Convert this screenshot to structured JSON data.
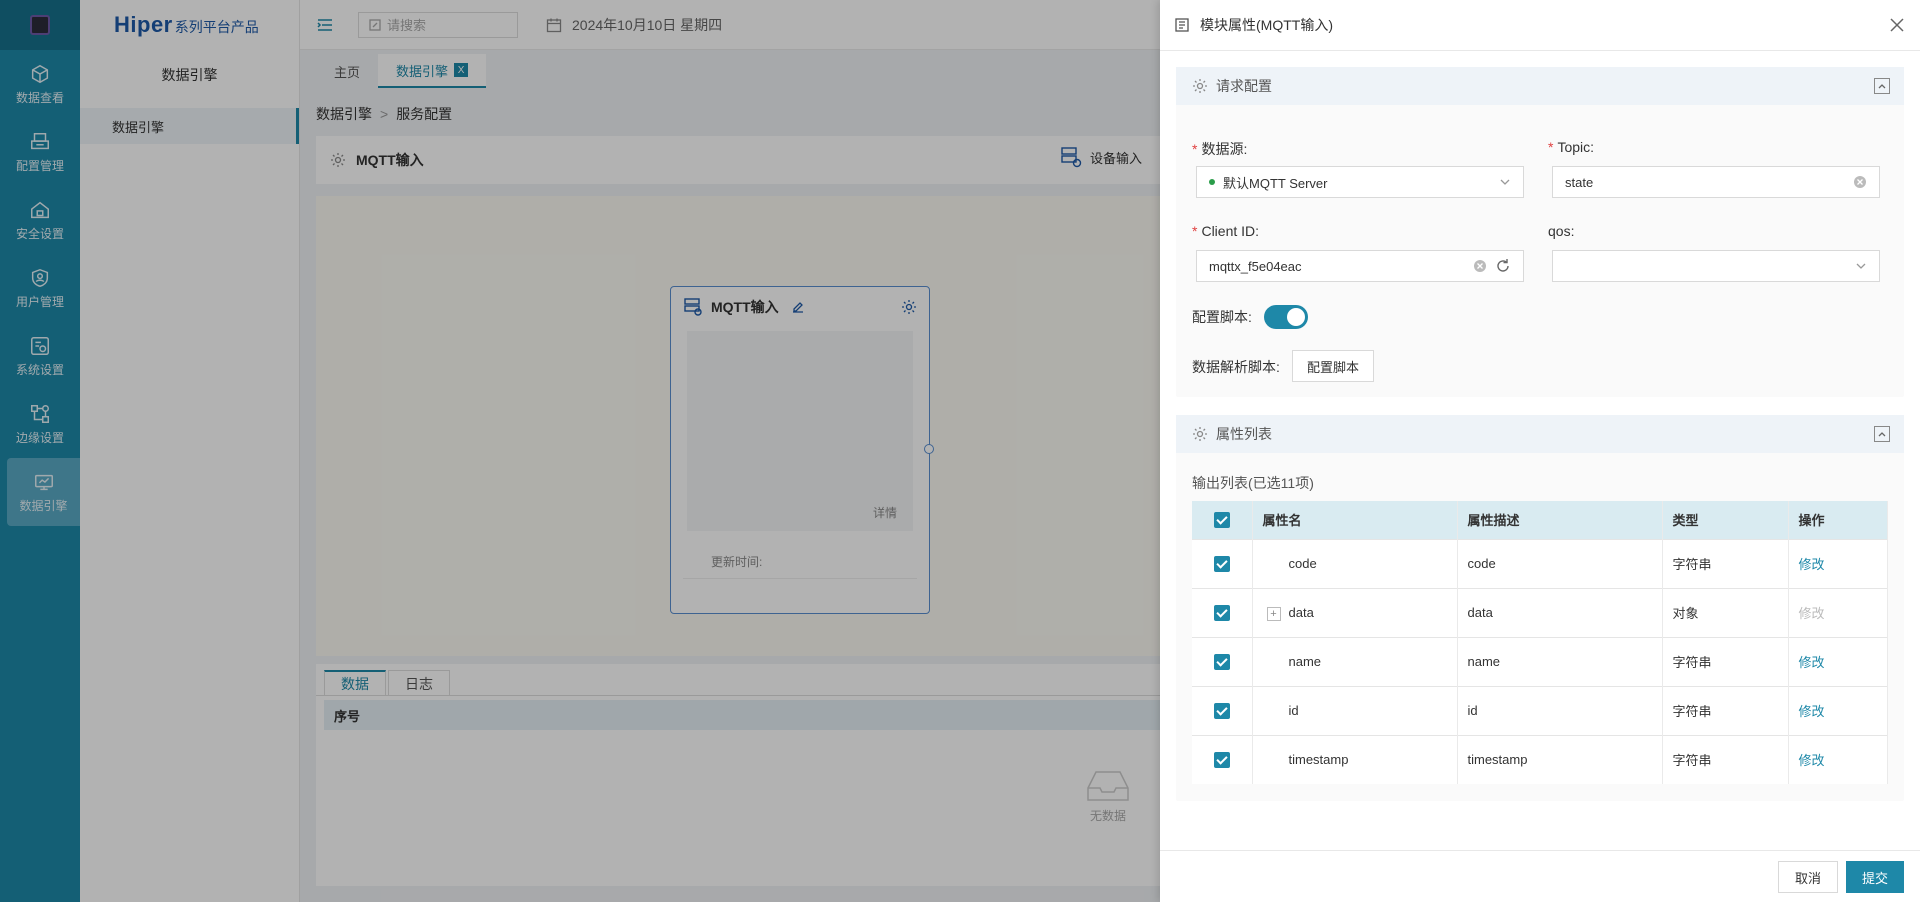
{
  "brand": {
    "name": "Hiper",
    "suffix": "系列平台产品"
  },
  "nav": [
    {
      "label": "数据查看",
      "icon": "cube-icon"
    },
    {
      "label": "配置管理",
      "icon": "printer-icon"
    },
    {
      "label": "安全设置",
      "icon": "home-lock-icon"
    },
    {
      "label": "用户管理",
      "icon": "shield-user-icon"
    },
    {
      "label": "系统设置",
      "icon": "system-settings-icon"
    },
    {
      "label": "边缘设置",
      "icon": "edge-nodes-icon"
    },
    {
      "label": "数据引擎",
      "icon": "data-engine-icon",
      "active": true
    }
  ],
  "sidebar": {
    "title": "数据引擎",
    "items": [
      {
        "label": "数据引擎"
      }
    ]
  },
  "topbar": {
    "search_placeholder": "请搜索",
    "date": "2024年10月10日 星期四"
  },
  "tabs": [
    {
      "label": "主页"
    },
    {
      "label": "数据引擎",
      "active": true,
      "close": "X"
    }
  ],
  "breadcrumb": {
    "first": "数据引擎",
    "sep": ">",
    "second": "服务配置"
  },
  "module": {
    "title": "MQTT输入",
    "device_button": "设备输入"
  },
  "card": {
    "title": "MQTT输入",
    "detail": "详情",
    "update_label": "更新时间:"
  },
  "bottom": {
    "tabs": [
      "数据",
      "日志"
    ],
    "col_seq": "序号",
    "empty": "无数据"
  },
  "drawer": {
    "title": "模块属性(MQTT输入)",
    "req_section": "请求配置",
    "fields": {
      "datasource_label": "数据源:",
      "datasource_value": "默认MQTT Server",
      "topic_label": "Topic:",
      "topic_value": "state",
      "clientid_label": "Client ID:",
      "clientid_value": "mqttx_f5e04eac",
      "qos_label": "qos:",
      "qos_value": "",
      "script_toggle_label": "配置脚本:",
      "script_toggle_on": true,
      "parse_script_label": "数据解析脚本:",
      "parse_script_button": "配置脚本"
    },
    "prop_section": "属性列表",
    "output_summary": "输出列表(已选11项)",
    "table": {
      "headers": [
        "属性名",
        "属性描述",
        "类型",
        "操作"
      ],
      "rows": [
        {
          "name": "code",
          "desc": "code",
          "type": "字符串",
          "action": "修改",
          "checked": true
        },
        {
          "name": "data",
          "desc": "data",
          "type": "对象",
          "action": "修改",
          "checked": true,
          "expandable": true,
          "disabled": true
        },
        {
          "name": "name",
          "desc": "name",
          "type": "字符串",
          "action": "修改",
          "checked": true
        },
        {
          "name": "id",
          "desc": "id",
          "type": "字符串",
          "action": "修改",
          "checked": true
        },
        {
          "name": "timestamp",
          "desc": "timestamp",
          "type": "字符串",
          "action": "修改",
          "checked": true
        }
      ]
    },
    "cancel": "取消",
    "submit": "提交"
  },
  "colors": {
    "accent": "#1e88a8",
    "sidebar": "#1e88a8",
    "required": "#e04040"
  }
}
